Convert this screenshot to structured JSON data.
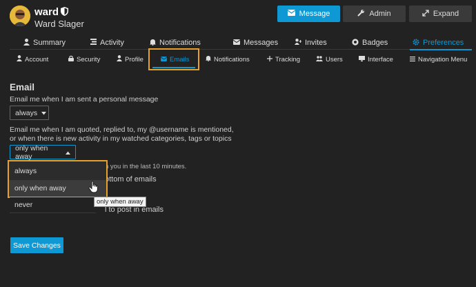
{
  "user": {
    "username": "ward",
    "full_name": "Ward Slager"
  },
  "header_buttons": {
    "message": "Message",
    "admin": "Admin",
    "expand": "Expand"
  },
  "main_tabs": [
    {
      "label": "Summary",
      "icon": "user-icon"
    },
    {
      "label": "Activity",
      "icon": "stream-icon"
    },
    {
      "label": "Notifications",
      "icon": "bell-icon"
    },
    {
      "label": "Messages",
      "icon": "envelope-icon"
    },
    {
      "label": "Invites",
      "icon": "user-plus-icon"
    },
    {
      "label": "Badges",
      "icon": "certificate-icon"
    },
    {
      "label": "Preferences",
      "icon": "gear-icon",
      "active": true
    }
  ],
  "sub_tabs": [
    {
      "label": "Account",
      "icon": "user-icon"
    },
    {
      "label": "Security",
      "icon": "lock-icon"
    },
    {
      "label": "Profile",
      "icon": "user-icon"
    },
    {
      "label": "Emails",
      "icon": "envelope-icon",
      "active": true
    },
    {
      "label": "Notifications",
      "icon": "bell-icon"
    },
    {
      "label": "Tracking",
      "icon": "plus-icon"
    },
    {
      "label": "Users",
      "icon": "users-icon"
    },
    {
      "label": "Interface",
      "icon": "desktop-icon"
    },
    {
      "label": "Navigation Menu",
      "icon": "bars-icon"
    }
  ],
  "email": {
    "section_title": "Email",
    "pm_label": "Email me when I am sent a personal message",
    "pm_value": "always",
    "quoted_label_line1": "Email me when I am quoted, replied to, my @username is mentioned,",
    "quoted_label_line2": "or when there is new activity in my watched categories, tags or topics",
    "quoted_value": "only when away",
    "dropdown_options": [
      "always",
      "only when away",
      "never"
    ],
    "hint_fragment": "n you in the last 10 minutes.",
    "fragment_2": "ottom of emails",
    "fragment_3": "l to post in emails"
  },
  "tooltip": "only when away",
  "save_label": "Save Changes",
  "colors": {
    "accent": "#0e98d4",
    "highlight_border": "#e8a12a",
    "background": "#222222"
  }
}
